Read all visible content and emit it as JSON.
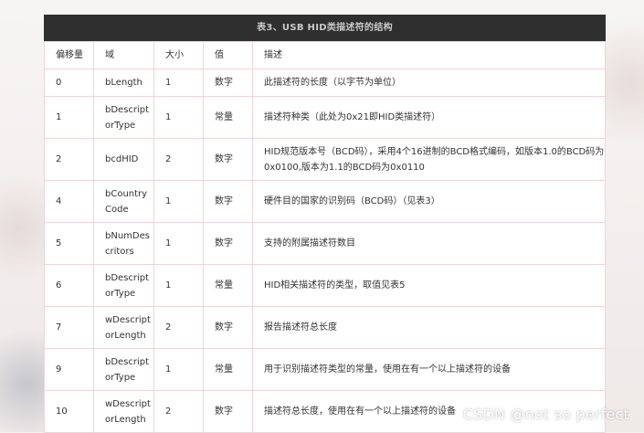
{
  "table": {
    "caption": "表3、USB HID类描述符的结构",
    "headers": [
      "偏移量",
      "域",
      "大小",
      "值",
      "描述"
    ],
    "rows": [
      [
        "0",
        "bLength",
        "1",
        "数字",
        "此描述符的长度（以字节为单位）"
      ],
      [
        "1",
        "bDescriptorType",
        "1",
        "常量",
        "描述符种类（此处为0x21即HID类描述符）"
      ],
      [
        "2",
        "bcdHID",
        "2",
        "数字",
        "HID规范版本号（BCD码），采用4个16进制的BCD格式编码，如版本1.0的BCD码为0x0100,版本为1.1的BCD码为0x0110"
      ],
      [
        "4",
        "bCountryCode",
        "1",
        "数字",
        "硬件目的国家的识别码（BCD码）（见表3）"
      ],
      [
        "5",
        "bNumDescritors",
        "1",
        "数字",
        "支持的附属描述符数目"
      ],
      [
        "6",
        "bDescriptorType",
        "1",
        "常量",
        "HID相关描述符的类型，取值见表5"
      ],
      [
        "7",
        "wDescriptorLength",
        "2",
        "数字",
        "报告描述符总长度"
      ],
      [
        "9",
        "bDescriptorType",
        "1",
        "常量",
        "用于识别描述符类型的常量，使用在有一个以上描述符的设备"
      ],
      [
        "10",
        "wDescriptorLength",
        "2",
        "数字",
        "描述符总长度，使用在有一个以上描述符的设备"
      ]
    ]
  },
  "watermark": "CSDN @not  so perfect"
}
